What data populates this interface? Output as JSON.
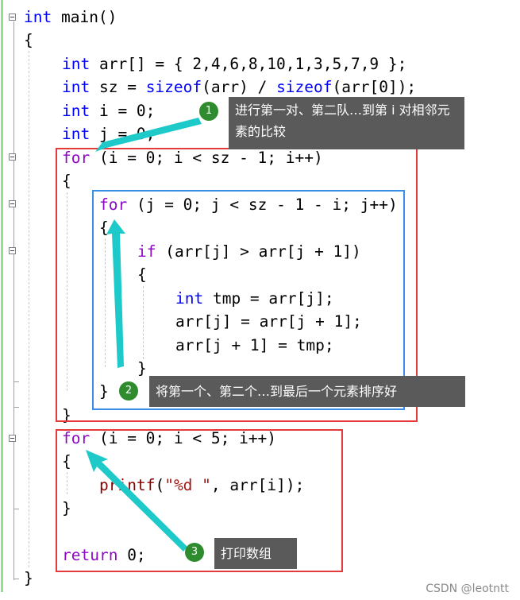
{
  "code": {
    "main_sig": {
      "kw": "int",
      "rest": " main()"
    },
    "brace_open": "{",
    "arr_decl": {
      "kw": "int",
      "rest": " arr[] = { 2,4,6,8,10,1,3,5,7,9 };"
    },
    "sz_decl": {
      "kw": "int",
      "rest1": " sz = ",
      "kw2": "sizeof",
      "rest2": "(arr) / ",
      "kw3": "sizeof",
      "rest3": "(arr[0]);"
    },
    "i_decl": {
      "kw": "int",
      "rest": " i = 0;"
    },
    "j_decl": {
      "kw": "int",
      "rest": " j = 0;"
    },
    "outer_for": {
      "kw": "for",
      "rest": " (i = 0; i < sz - 1; i++)"
    },
    "outer_open": "{",
    "inner_for": {
      "kw": "for",
      "rest": " (j = 0; j < sz - 1 - i; j++)"
    },
    "inner_open": "{",
    "if_line": {
      "kw": "if",
      "rest": " (arr[j] > arr[j + 1])"
    },
    "if_open": "{",
    "tmp_decl": {
      "kw": "int",
      "rest": " tmp = arr[j];"
    },
    "assign1": "arr[j] = arr[j + 1];",
    "assign2": "arr[j + 1] = tmp;",
    "if_close": "}",
    "inner_close": "}",
    "outer_close": "}",
    "print_for": {
      "kw": "for",
      "rest": " (i = 0; i < 5; i++)"
    },
    "print_open": "{",
    "printf_line": {
      "fn": "printf",
      "p1": "(",
      "str": "\"%d \"",
      "p2": ", arr[i]);"
    },
    "print_close": "}",
    "return_line": {
      "kw": "return",
      "rest": " 0;"
    },
    "brace_close": "}"
  },
  "annotations": [
    {
      "number": "1",
      "text": "进行第一对、第二队…到第 i 对相邻元素的比较"
    },
    {
      "number": "2",
      "text": "将第一个、第二个…到最后一个元素排序好"
    },
    {
      "number": "3",
      "text": "打印数组"
    }
  ],
  "colors": {
    "keyword": "#0000ff",
    "control_keyword": "#8f08c4",
    "red_box": "#e53a3a",
    "blue_box": "#3a8ee5",
    "arrow": "#1ec9c9",
    "badge": "#2e8b2e"
  },
  "watermark": "CSDN @leotntt"
}
